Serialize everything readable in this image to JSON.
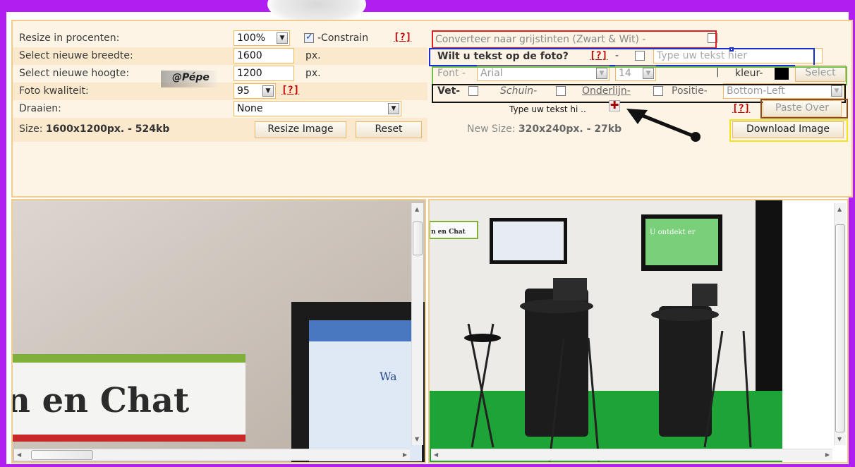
{
  "controls": {
    "resize_label": "Resize in procenten:",
    "resize_value": "100%",
    "constrain_label": "-Constrain",
    "help": "[?]",
    "width_label": "Select nieuwe breedte:",
    "width_value": "1600",
    "height_label": "Select nieuwe hoogte:",
    "height_value": "1200",
    "px": "px.",
    "quality_label": "Foto kwaliteit:",
    "quality_value": "95",
    "rotate_label": "Draaien:",
    "rotate_value": "None",
    "size_prefix": "Size:",
    "size_value": "1600x1200px. - 524kb",
    "resize_button": "Resize Image",
    "reset_button": "Reset",
    "watermark": "@Pépe"
  },
  "text_tools": {
    "grayscale_label": "Converteer naar grijstinten (Zwart & Wit) -",
    "text_question": "Wilt u tekst op de foto?",
    "help": "[?]",
    "dash": "-",
    "text_placeholder": "Type uw tekst hier",
    "font_label": "Font -",
    "font_value": "Arial",
    "size_value": "14",
    "color_label": "kleur-",
    "color_value": "#000000",
    "select_button": "Select",
    "bold_label": "Vet-",
    "italic_label": "Schuin-",
    "underline_label": "Onderlijn-",
    "position_label": "Positie-",
    "position_value": "Bottom-Left",
    "preview_text": "Type uw tekst hi ..",
    "paste_over_button": "Paste Over",
    "new_size_prefix": "New Size:",
    "new_size_value": "320x240px. - 27kb",
    "download_button": "Download Image"
  },
  "highlights": {
    "red": "#e02020",
    "blue": "#1a2fd0",
    "green": "#6cc04a",
    "black": "#111111",
    "brown": "#8a4a1c",
    "yellow": "#f5e31a",
    "accent": "#b01ef0"
  },
  "preview_left": {
    "sign_text": "n en Chat",
    "browser_heading": "Wa"
  },
  "preview_right": {
    "sign_text": "n en Chat",
    "tv_text": "U ontdekt er alles over, hier in de groep BLOGGEN\""
  }
}
